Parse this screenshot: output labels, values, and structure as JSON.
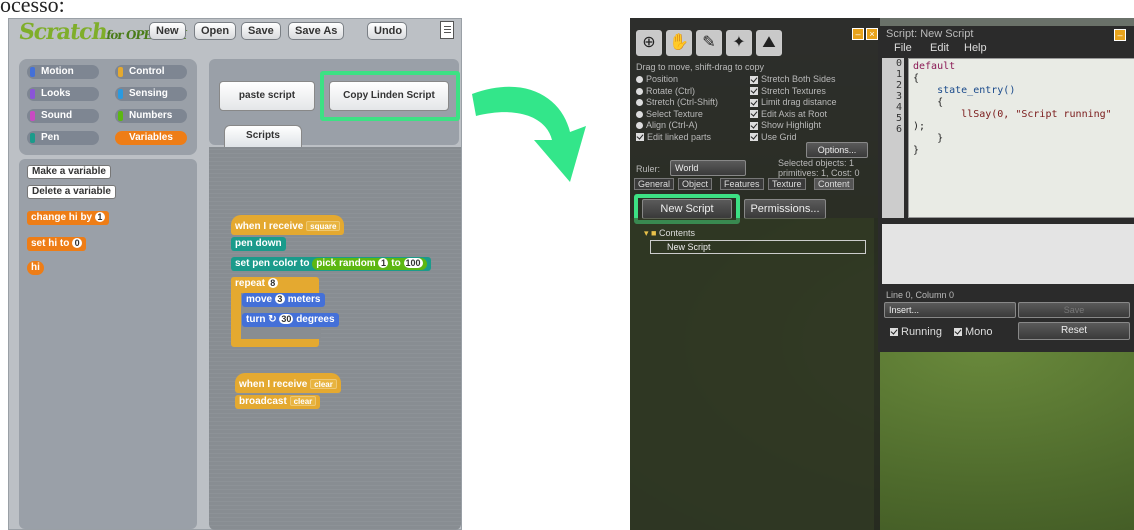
{
  "caption": "ocesso:",
  "scratch": {
    "logo_main": "Scratch",
    "logo_sub": "for OPENSIM",
    "toolbar": {
      "new": "New",
      "open": "Open",
      "save": "Save",
      "save_as": "Save As",
      "undo": "Undo"
    },
    "categories": [
      {
        "label": "Motion",
        "color": "#4470d8"
      },
      {
        "label": "Control",
        "color": "#e4a930"
      },
      {
        "label": "Looks",
        "color": "#8a55d8"
      },
      {
        "label": "Sensing",
        "color": "#2a9ae0"
      },
      {
        "label": "Sound",
        "color": "#c74ac2"
      },
      {
        "label": "Numbers",
        "color": "#5cb712"
      },
      {
        "label": "Pen",
        "color": "#1b9b8b"
      },
      {
        "label": "Variables",
        "color": "#ee7d16"
      }
    ],
    "active_category": "Variables",
    "palette": {
      "make_variable": "Make a variable",
      "delete_variable": "Delete a variable",
      "change_by": "change hi by",
      "change_value": "1",
      "set_to": "set hi to",
      "set_value": "0",
      "var_name": "hi"
    },
    "paste_script": "paste script",
    "copy_linden": "Copy Linden Script",
    "scripts_tab": "Scripts",
    "script1": {
      "when_receive": "when I receive",
      "message": "square",
      "pen_down": "pen down",
      "set_pen_color": "set pen color to",
      "pick_random": "pick random",
      "rand_from": "1",
      "rand_to_word": "to",
      "rand_to": "100",
      "repeat": "repeat",
      "repeat_count": "8",
      "move": "move",
      "move_value": "3",
      "meters": "meters",
      "turn": "turn",
      "turn_value": "30",
      "degrees": "degrees"
    },
    "script2": {
      "when_receive": "when I receive",
      "message": "clear",
      "broadcast": "broadcast",
      "broadcast_msg": "clear"
    }
  },
  "secondlife": {
    "build": {
      "drag_hint": "Drag to move, shift-drag to copy",
      "left_opts": [
        "Position",
        "Rotate (Ctrl)",
        "Stretch (Ctrl-Shift)",
        "Select Texture",
        "Align (Ctrl-A)",
        "Edit linked parts"
      ],
      "right_opts": [
        "Stretch Both Sides",
        "Stretch Textures",
        "Limit drag distance",
        "Edit Axis at Root",
        "Show Highlight",
        "Use Grid"
      ],
      "options_btn": "Options...",
      "ruler_label": "Ruler:",
      "ruler_value": "World",
      "selected_info": "Selected objects: 1",
      "primitives_info": "primitives: 1, Cost: 0",
      "tabs": [
        "General",
        "Object",
        "Features",
        "Texture",
        "Content"
      ],
      "new_script": "New Script",
      "permissions": "Permissions...",
      "contents_folder": "Contents",
      "item_new_script": "New Script"
    },
    "editor": {
      "title": "Script: New Script",
      "menu": [
        "File",
        "Edit",
        "Help"
      ],
      "line_numbers": [
        "0",
        "1",
        "2",
        "3",
        "4",
        "",
        "5",
        "6"
      ],
      "code_lines": [
        "default",
        "{",
        "    state_entry()",
        "    {",
        "        llSay(0, \"Script running\"",
        ");",
        "    }",
        "}"
      ],
      "status": "Line 0, Column 0",
      "insert": "Insert...",
      "save": "Save",
      "running": "Running",
      "mono": "Mono",
      "reset": "Reset"
    }
  }
}
